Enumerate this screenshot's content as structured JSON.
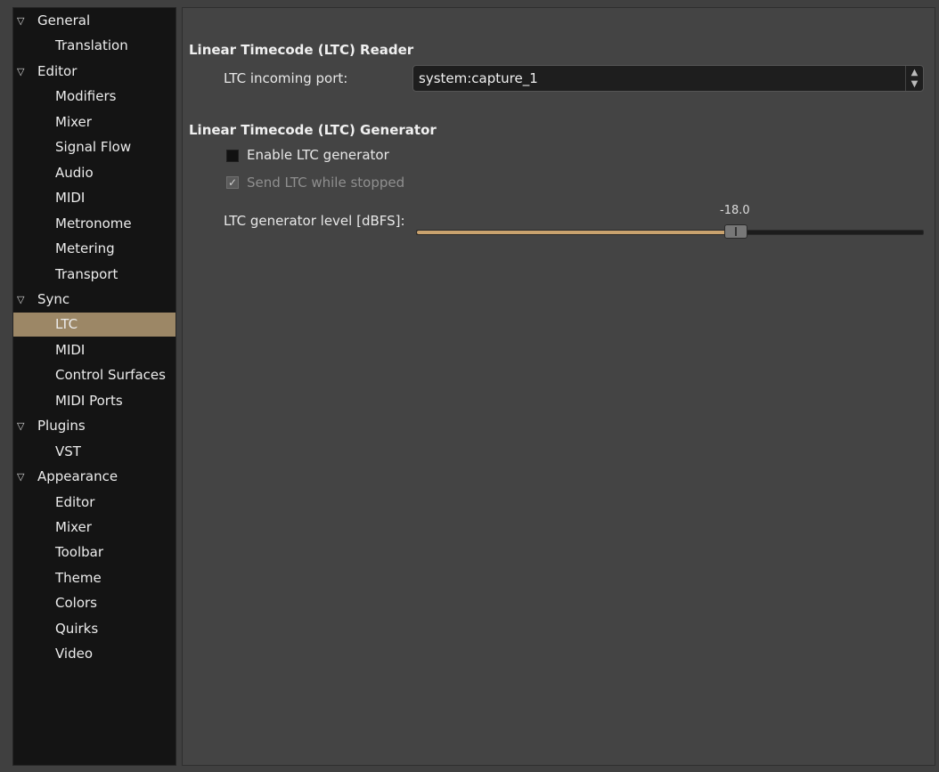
{
  "sidebar": {
    "items": [
      {
        "label": "General",
        "expander": true
      },
      {
        "label": "Translation",
        "expander": false
      },
      {
        "label": "Editor",
        "expander": true
      },
      {
        "label": "Modifiers",
        "expander": false
      },
      {
        "label": "Mixer",
        "expander": false
      },
      {
        "label": "Signal Flow",
        "expander": false
      },
      {
        "label": "Audio",
        "expander": false
      },
      {
        "label": "MIDI",
        "expander": false
      },
      {
        "label": "Metronome",
        "expander": false
      },
      {
        "label": "Metering",
        "expander": false
      },
      {
        "label": "Transport",
        "expander": false
      },
      {
        "label": "Sync",
        "expander": true
      },
      {
        "label": "LTC",
        "expander": false,
        "selected": true
      },
      {
        "label": "MIDI",
        "expander": false
      },
      {
        "label": "Control Surfaces",
        "expander": false
      },
      {
        "label": "MIDI Ports",
        "expander": false
      },
      {
        "label": "Plugins",
        "expander": true
      },
      {
        "label": "VST",
        "expander": false
      },
      {
        "label": "Appearance",
        "expander": true
      },
      {
        "label": "Editor",
        "expander": false
      },
      {
        "label": "Mixer",
        "expander": false
      },
      {
        "label": "Toolbar",
        "expander": false
      },
      {
        "label": "Theme",
        "expander": false
      },
      {
        "label": "Colors",
        "expander": false
      },
      {
        "label": "Quirks",
        "expander": false
      },
      {
        "label": "Video",
        "expander": false
      }
    ],
    "expander_icon": "triangle-down",
    "selected_color": "#9c8766"
  },
  "ltc_reader": {
    "title": "Linear Timecode (LTC) Reader",
    "port_label": "LTC incoming port:",
    "port_value": "system:capture_1",
    "port_icon": "updown-arrows"
  },
  "ltc_generator": {
    "title": "Linear Timecode (LTC) Generator",
    "enable_label": "Enable LTC generator",
    "enable_checked": false,
    "send_stopped_label": "Send LTC while stopped",
    "send_stopped_checked": true,
    "send_stopped_enabled": false,
    "level_label": "LTC generator level [dBFS]:",
    "level_value": "-18.0",
    "level_fraction": 0.63,
    "level_fill_color": "#c9a26e"
  }
}
